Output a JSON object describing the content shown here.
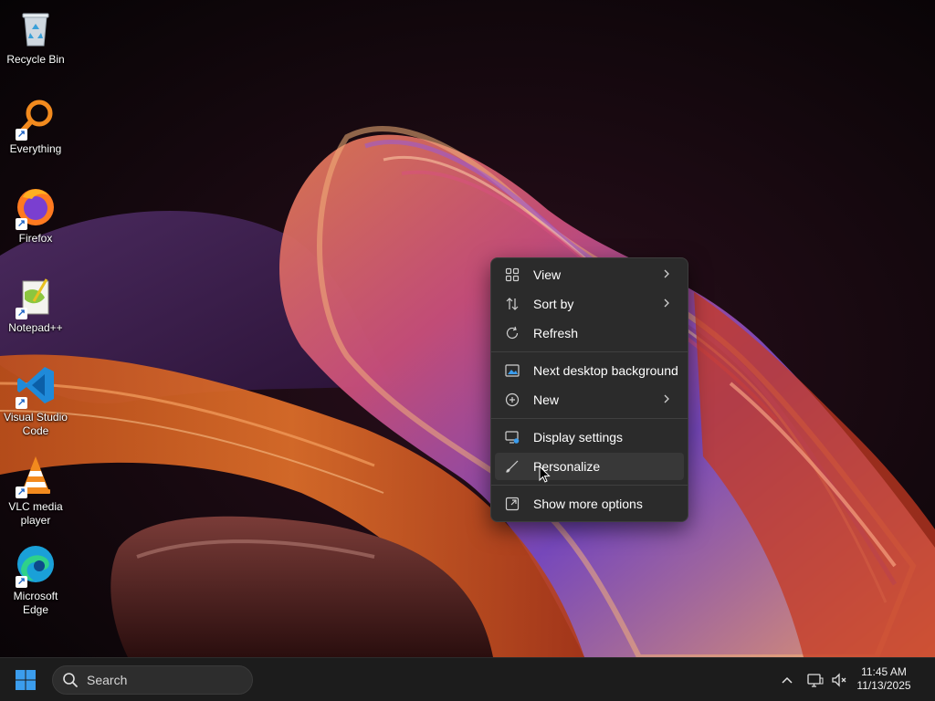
{
  "desktop": {
    "icons": [
      {
        "label": "Recycle Bin",
        "icon": "recycle-bin-icon"
      },
      {
        "label": "Everything",
        "icon": "everything-search-icon"
      },
      {
        "label": "Firefox",
        "icon": "firefox-icon"
      },
      {
        "label": "Notepad++",
        "icon": "notepad-plus-plus-icon"
      },
      {
        "label": "Visual Studio Code",
        "icon": "vscode-icon"
      },
      {
        "label": "VLC media player",
        "icon": "vlc-icon"
      },
      {
        "label": "Microsoft Edge",
        "icon": "edge-icon"
      }
    ]
  },
  "context_menu": {
    "items": [
      {
        "label": "View",
        "icon": "grid-view-icon",
        "submenu": true
      },
      {
        "label": "Sort by",
        "icon": "sort-arrows-icon",
        "submenu": true
      },
      {
        "label": "Refresh",
        "icon": "refresh-icon",
        "submenu": false
      },
      {
        "label": "Next desktop background",
        "icon": "next-background-icon",
        "submenu": false
      },
      {
        "label": "New",
        "icon": "new-plus-icon",
        "submenu": true
      },
      {
        "label": "Display settings",
        "icon": "display-settings-icon",
        "submenu": false
      },
      {
        "label": "Personalize",
        "icon": "brush-icon",
        "submenu": false,
        "hovered": true
      },
      {
        "label": "Show more options",
        "icon": "show-more-icon",
        "submenu": false
      }
    ]
  },
  "taskbar": {
    "search_placeholder": "Search",
    "time": "11:45 AM",
    "date": "11/13/2025",
    "accent": "#3b9ded"
  }
}
